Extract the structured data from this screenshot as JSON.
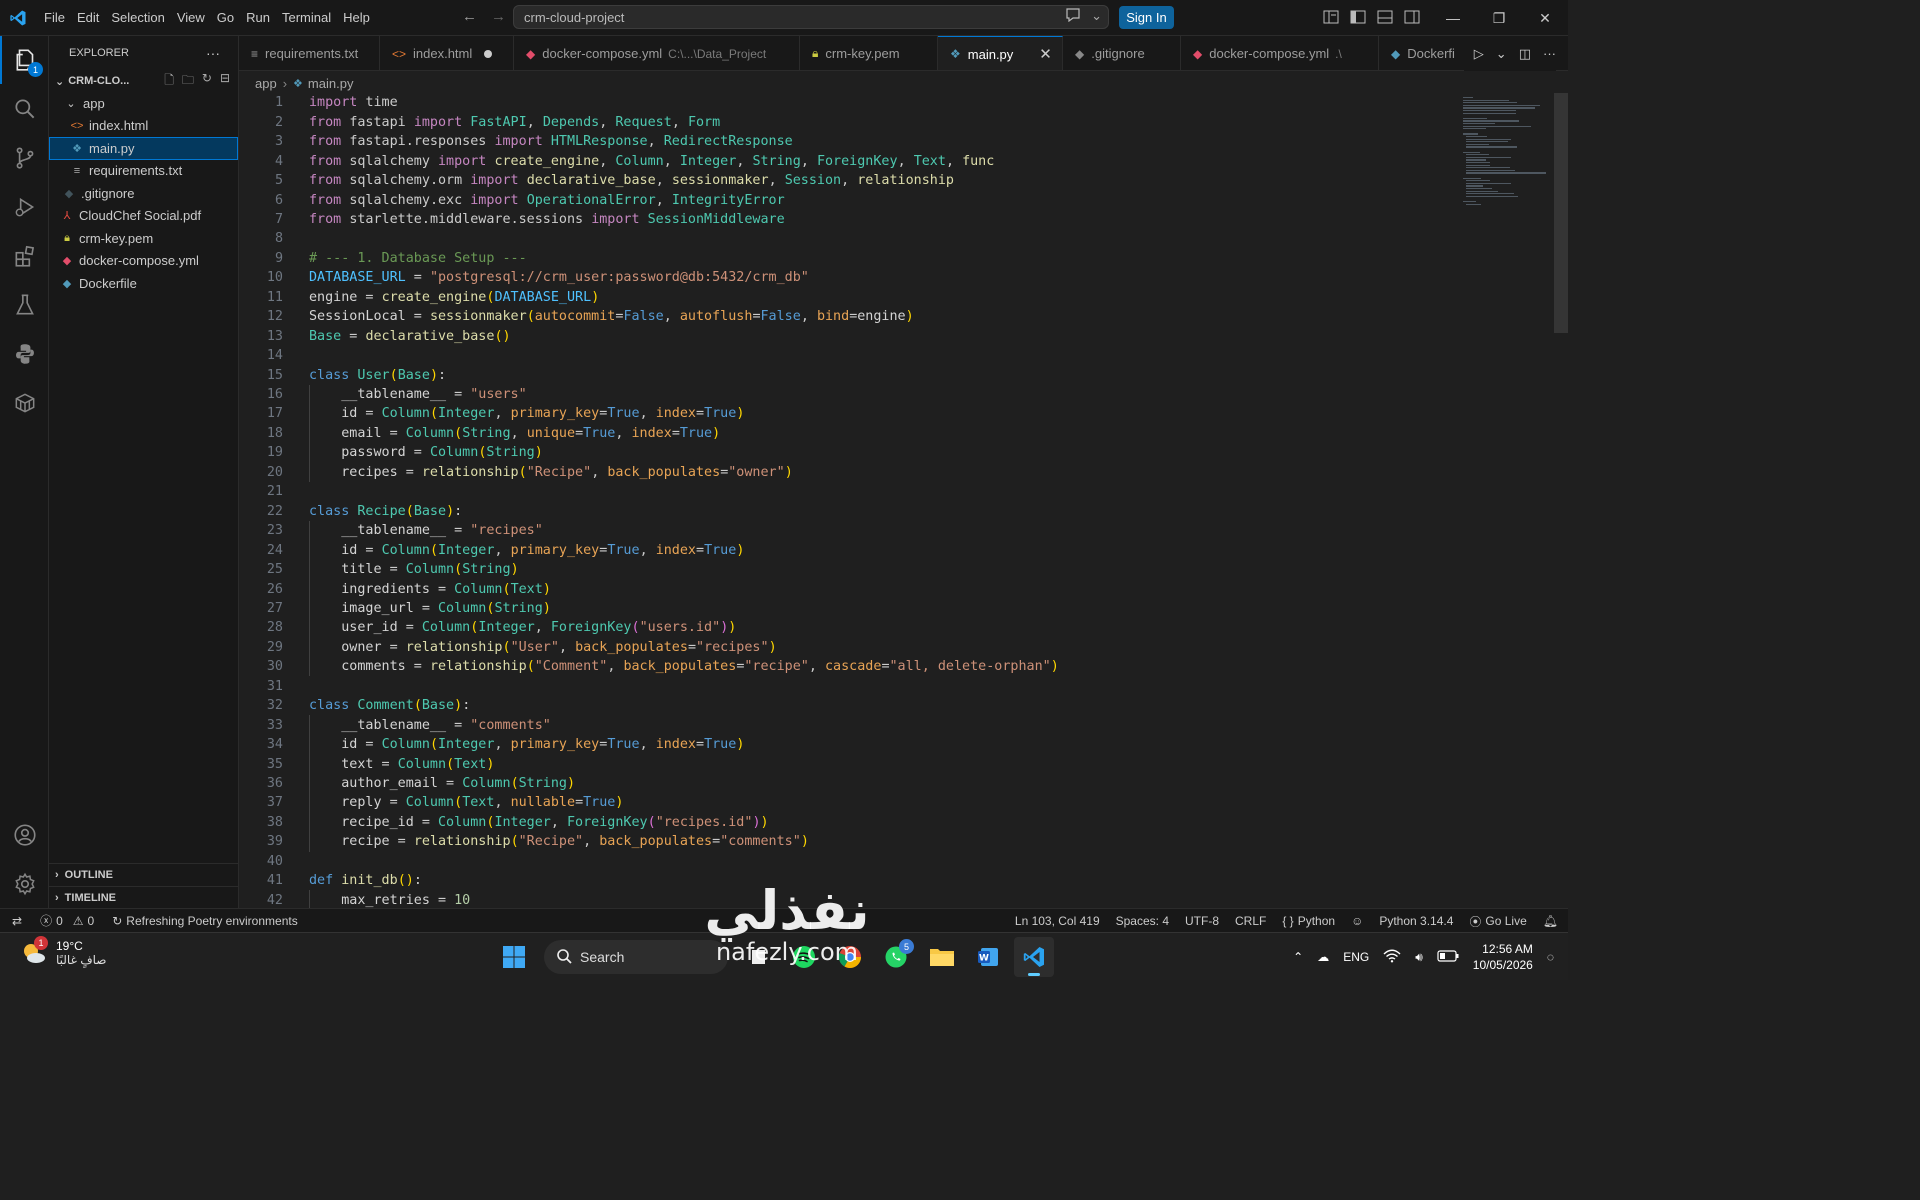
{
  "title_bar": {
    "menu": [
      "File",
      "Edit",
      "Selection",
      "View",
      "Go",
      "Run",
      "Terminal",
      "Help"
    ],
    "command_center": "crm-cloud-project",
    "sign_in": "Sign In"
  },
  "activity_bar": {
    "explorer_badge": "1",
    "items": [
      "explorer-icon",
      "search-icon",
      "source-control-icon",
      "run-debug-icon",
      "extensions-icon",
      "testing-icon",
      "python-icon",
      "containers-icon",
      "accounts-icon",
      "manage-gear-icon"
    ]
  },
  "sidebar": {
    "title": "EXPLORER",
    "root_folder": "CRM-CLO...",
    "items": [
      {
        "label": "app",
        "icon": "chevron-down-icon"
      },
      {
        "label": "index.html",
        "icon": "html-file-icon"
      },
      {
        "label": "main.py",
        "icon": "python-file-icon"
      },
      {
        "label": "requirements.txt",
        "icon": "text-file-icon"
      },
      {
        "label": ".gitignore",
        "icon": "git-file-icon"
      },
      {
        "label": "CloudChef Social.pdf",
        "icon": "pdf-file-icon"
      },
      {
        "label": "crm-key.pem",
        "icon": "lock-file-icon"
      },
      {
        "label": "docker-compose.yml",
        "icon": "docker-compose-file-icon"
      },
      {
        "label": "Dockerfile",
        "icon": "docker-file-icon"
      }
    ],
    "outline": "OUTLINE",
    "timeline": "TIMELINE"
  },
  "tabs": [
    {
      "label": "requirements.txt"
    },
    {
      "label": "index.html"
    },
    {
      "label": "docker-compose.yml",
      "path": "C:\\...\\Data_Project"
    },
    {
      "label": "crm-key.pem"
    },
    {
      "label": "main.py"
    },
    {
      "label": ".gitignore"
    },
    {
      "label": "docker-compose.yml",
      "path": ".\\"
    },
    {
      "label": "Dockerfi"
    }
  ],
  "breadcrumb": {
    "folder": "app",
    "file": "main.py"
  },
  "code_lines": [
    "import time",
    "from fastapi import FastAPI, Depends, Request, Form",
    "from fastapi.responses import HTMLResponse, RedirectResponse",
    "from sqlalchemy import create_engine, Column, Integer, String, ForeignKey, Text, func",
    "from sqlalchemy.orm import declarative_base, sessionmaker, Session, relationship",
    "from sqlalchemy.exc import OperationalError, IntegrityError",
    "from starlette.middleware.sessions import SessionMiddleware",
    "",
    "# --- 1. Database Setup ---",
    "DATABASE_URL = \"postgresql://crm_user:password@db:5432/crm_db\"",
    "engine = create_engine(DATABASE_URL)",
    "SessionLocal = sessionmaker(autocommit=False, autoflush=False, bind=engine)",
    "Base = declarative_base()",
    "",
    "class User(Base):",
    "    __tablename__ = \"users\"",
    "    id = Column(Integer, primary_key=True, index=True)",
    "    email = Column(String, unique=True, index=True)",
    "    password = Column(String)",
    "    recipes = relationship(\"Recipe\", back_populates=\"owner\")",
    "",
    "class Recipe(Base):",
    "    __tablename__ = \"recipes\"",
    "    id = Column(Integer, primary_key=True, index=True)",
    "    title = Column(String)",
    "    ingredients = Column(Text)",
    "    image_url = Column(String)",
    "    user_id = Column(Integer, ForeignKey(\"users.id\"))",
    "    owner = relationship(\"User\", back_populates=\"recipes\")",
    "    comments = relationship(\"Comment\", back_populates=\"recipe\", cascade=\"all, delete-orphan\")",
    "",
    "class Comment(Base):",
    "    __tablename__ = \"comments\"",
    "    id = Column(Integer, primary_key=True, index=True)",
    "    text = Column(Text)",
    "    author_email = Column(String)",
    "    reply = Column(Text, nullable=True)",
    "    recipe_id = Column(Integer, ForeignKey(\"recipes.id\"))",
    "    recipe = relationship(\"Recipe\", back_populates=\"comments\")",
    "",
    "def init_db():",
    "    max_retries = 10"
  ],
  "status_bar": {
    "errors": "0",
    "warnings": "0",
    "message": "Refreshing Poetry environments",
    "position": "Ln 103, Col 419",
    "spaces": "Spaces: 4",
    "encoding": "UTF-8",
    "eol": "CRLF",
    "language": "Python",
    "interpreter": "Python 3.14.4",
    "go_live": "Go Live"
  },
  "taskbar": {
    "weather_temp": "19°C",
    "weather_desc": "صافٍ غالبًا",
    "weather_badge": "1",
    "search": "Search",
    "whatsapp_badge": "5",
    "language": "ENG",
    "time": "12:56 AM",
    "date": "10/05/2026"
  },
  "watermark": {
    "arabic": "نفذلي",
    "latin": "nafezly.com"
  }
}
